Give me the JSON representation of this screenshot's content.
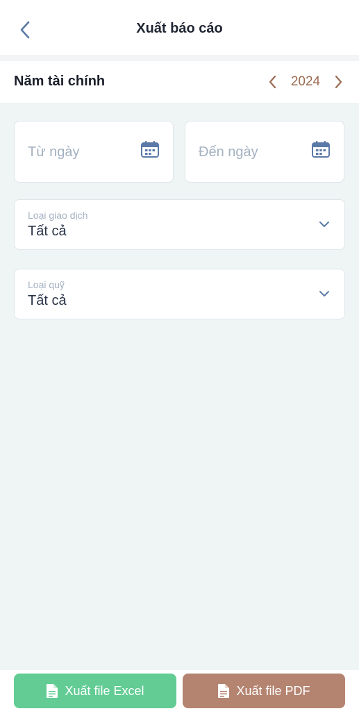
{
  "header": {
    "title": "Xuất báo cáo",
    "back_icon": "chevron-left-icon"
  },
  "year_selector": {
    "label": "Năm tài chính",
    "value": "2024",
    "prev_icon": "chevron-left-icon",
    "next_icon": "chevron-right-icon"
  },
  "date_range": {
    "from_placeholder": "Từ ngày",
    "to_placeholder": "Đến ngày",
    "icon": "calendar-icon"
  },
  "transaction_type": {
    "label": "Loại giao dịch",
    "value": "Tất cả"
  },
  "fund_type": {
    "label": "Loại quỹ",
    "value": "Tất cả"
  },
  "actions": {
    "excel_label": "Xuất file Excel",
    "pdf_label": "Xuất file PDF"
  },
  "colors": {
    "accent_brown": "#9a6a50",
    "excel_green": "#62cc94",
    "pdf_brown": "#b48470",
    "icon_blue": "#5b7aa8"
  }
}
